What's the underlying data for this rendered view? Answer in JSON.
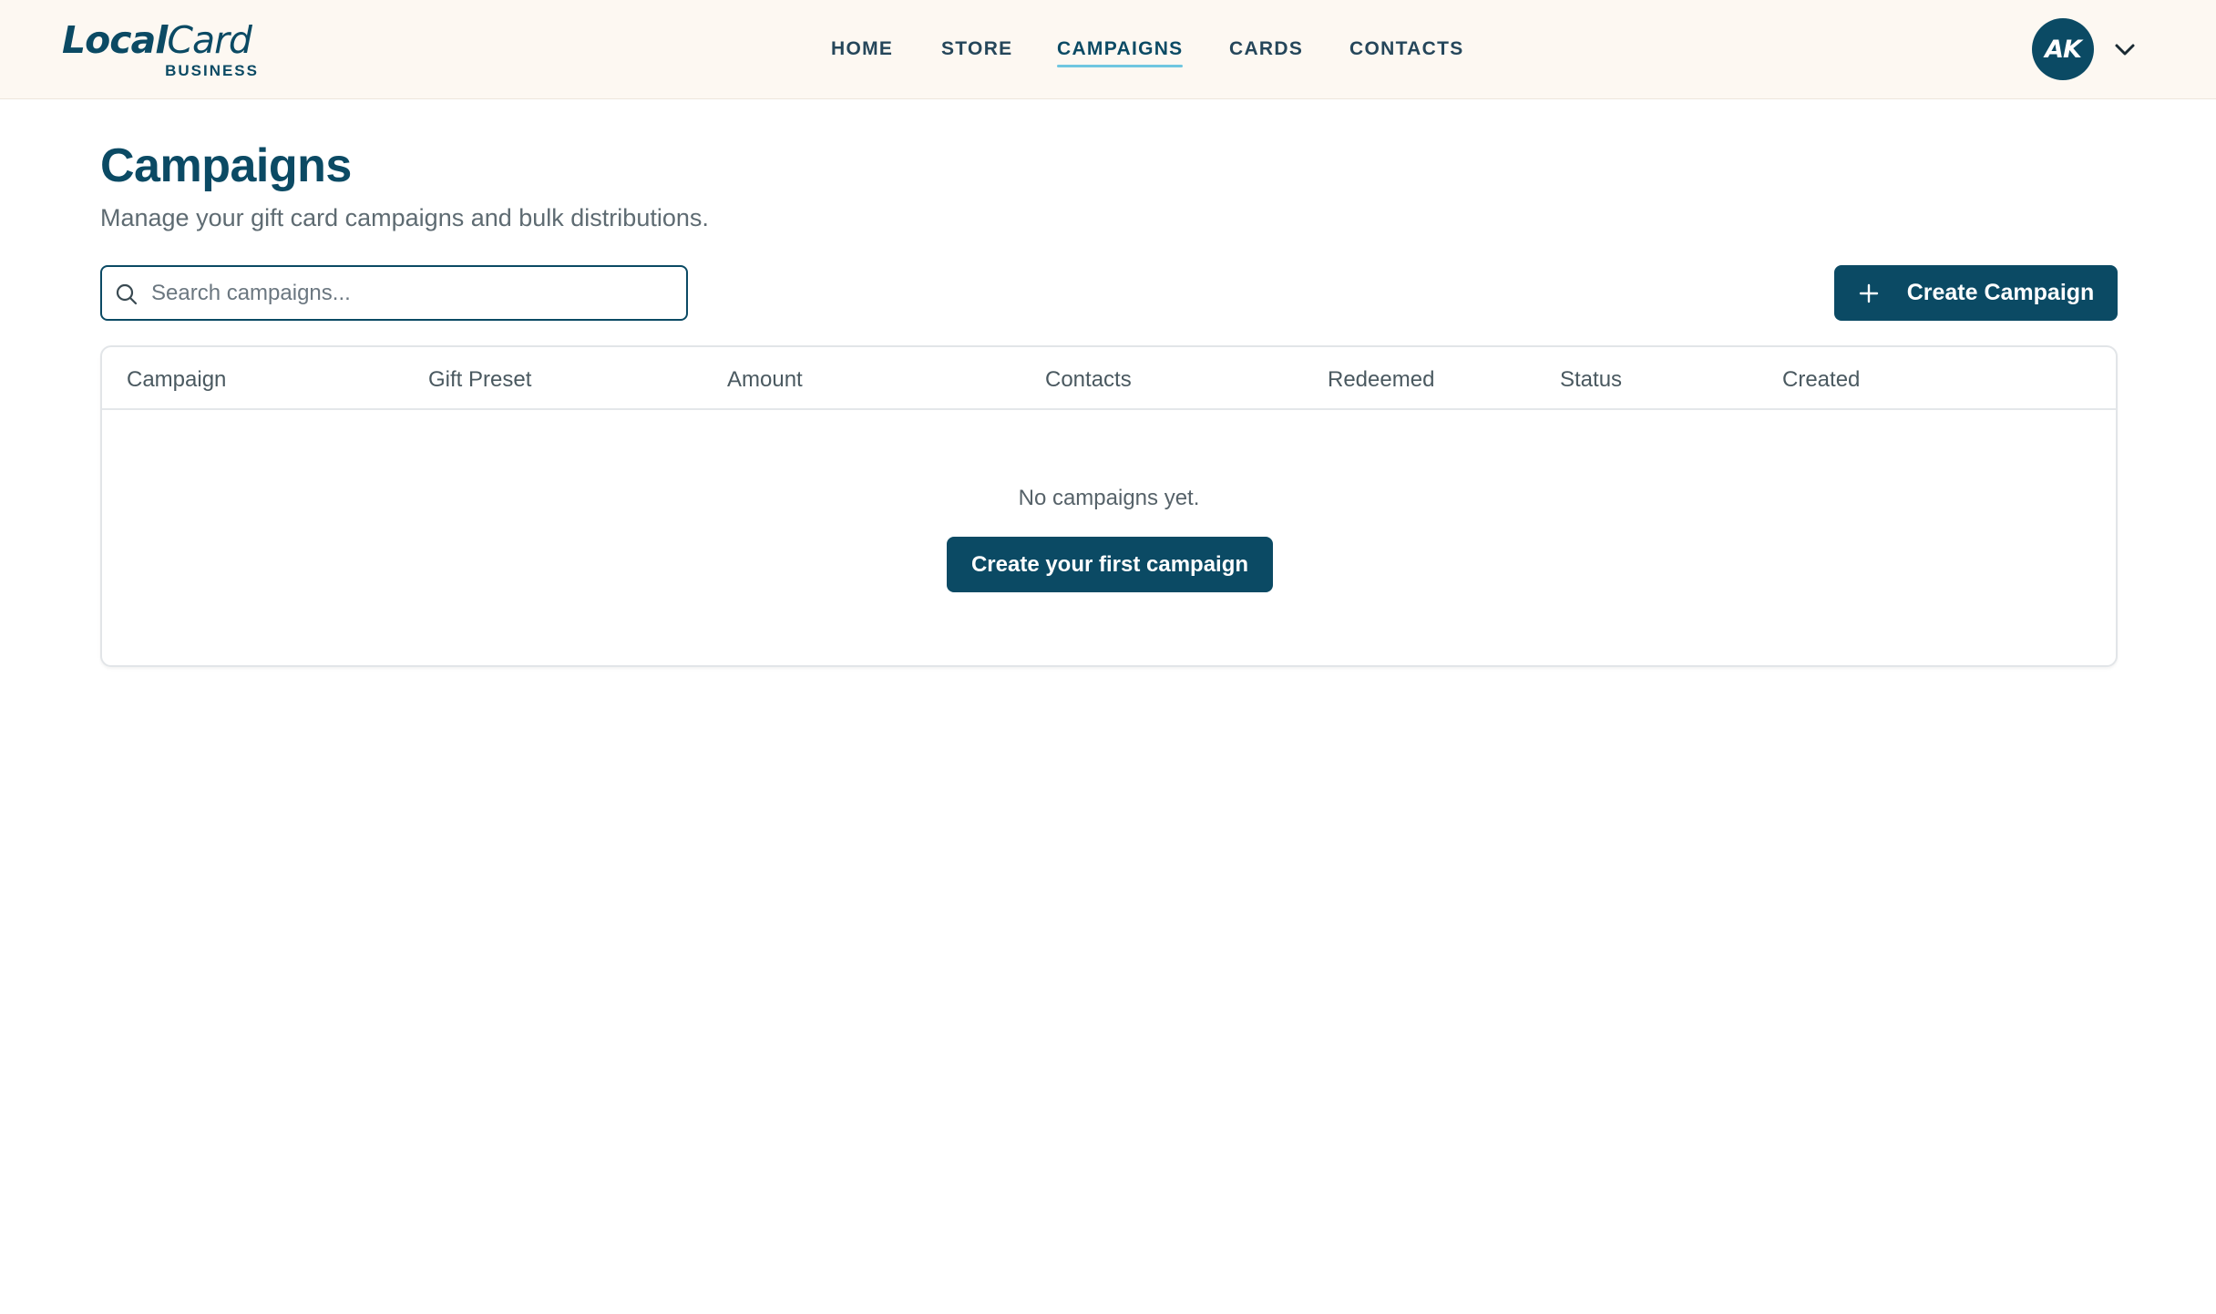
{
  "brand": {
    "logo_local": "Local",
    "logo_card": "Card",
    "logo_sub": "BUSINESS"
  },
  "nav": {
    "items": [
      {
        "label": "HOME"
      },
      {
        "label": "STORE"
      },
      {
        "label": "CAMPAIGNS",
        "active": true
      },
      {
        "label": "CARDS"
      },
      {
        "label": "CONTACTS"
      }
    ]
  },
  "user": {
    "initials": "AK",
    "menu_icon": "chevron-down-icon"
  },
  "page": {
    "title": "Campaigns",
    "subtitle": "Manage your gift card campaigns and bulk distributions."
  },
  "search": {
    "placeholder": "Search campaigns...",
    "value": "",
    "icon": "search-icon"
  },
  "toolbar": {
    "create_label": "Create Campaign",
    "create_icon": "plus-icon"
  },
  "table": {
    "columns": [
      "Campaign",
      "Gift Preset",
      "Amount",
      "Contacts",
      "Redeemed",
      "Status",
      "Created"
    ],
    "rows": [],
    "empty_text": "No campaigns yet.",
    "empty_action_label": "Create your first campaign"
  },
  "colors": {
    "primary": "#0b4a64",
    "nav_active_underline": "#6fc6e0",
    "header_bg": "#fdf8f2"
  }
}
